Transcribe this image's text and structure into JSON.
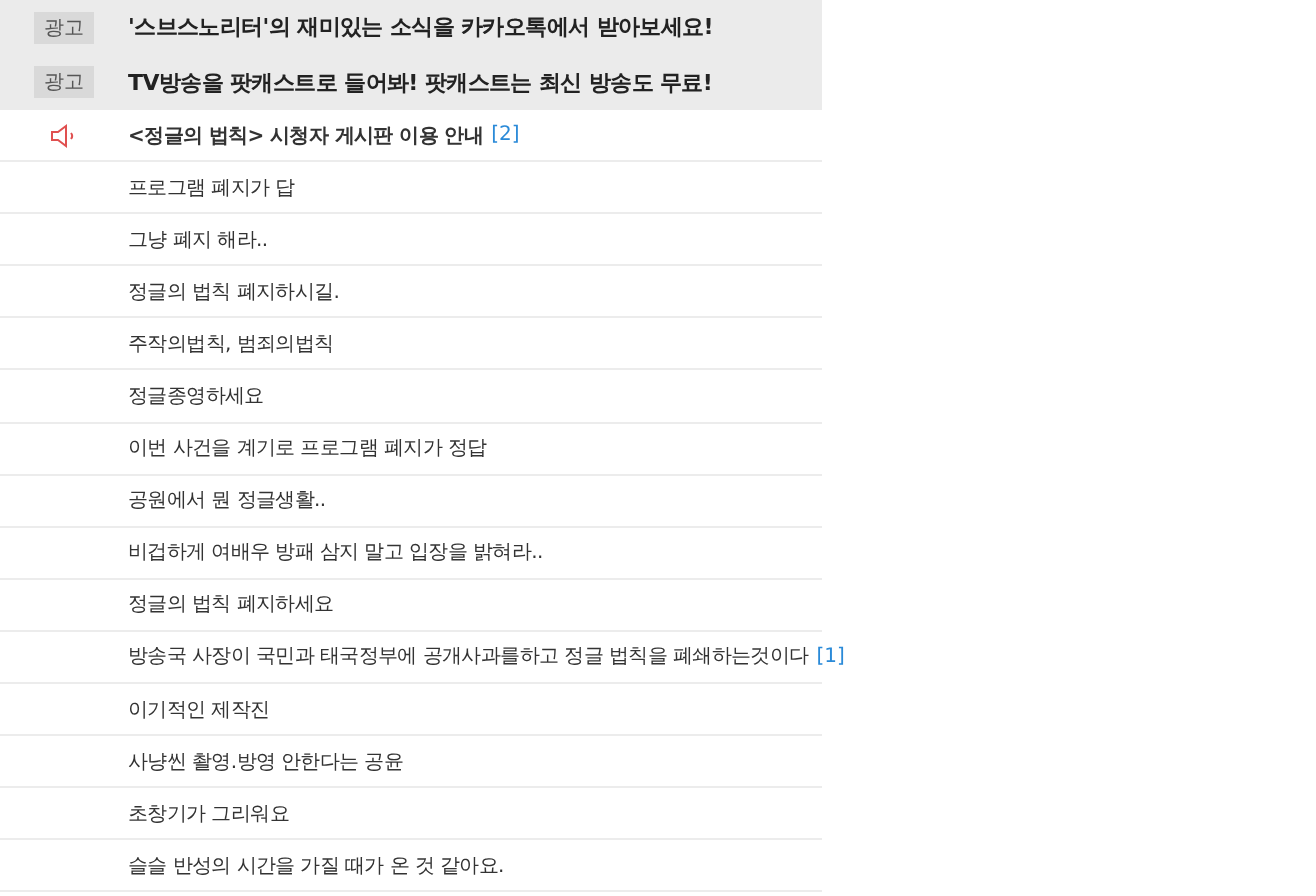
{
  "rows": [
    {
      "kind": "ad",
      "badge": "광고",
      "title": "'스브스노리터'의 재미있는 소식을 카카오톡에서 받아보세요!"
    },
    {
      "kind": "ad",
      "badge": "광고",
      "title": "TV방송을 팟캐스트로 들어봐! 팟캐스트는 최신 방송도 무료!"
    },
    {
      "kind": "notice",
      "title": "<정글의 법칙> 시청자 게시판 이용 안내",
      "comments": "[2]"
    },
    {
      "kind": "post",
      "title": "프로그램 폐지가 답"
    },
    {
      "kind": "post",
      "title": "그냥 폐지 해라.."
    },
    {
      "kind": "post",
      "title": "정글의 법칙 폐지하시길."
    },
    {
      "kind": "post",
      "title": "주작의법칙, 범죄의법칙"
    },
    {
      "kind": "post",
      "title": "정글종영하세요"
    },
    {
      "kind": "post",
      "title": "이번 사건을 계기로 프로그램 폐지가 정답"
    },
    {
      "kind": "post",
      "title": "공원에서 뭔 정글생활.."
    },
    {
      "kind": "post",
      "title": "비겁하게 여배우 방패 삼지 말고 입장을 밝혀라.."
    },
    {
      "kind": "post",
      "title": "정글의 법칙 폐지하세요"
    },
    {
      "kind": "post",
      "title": "방송국 사장이 국민과 태국정부에 공개사과를하고 정글 법칙을 폐쇄하는것이다",
      "comments": "[1]"
    },
    {
      "kind": "post",
      "title": "이기적인 제작진"
    },
    {
      "kind": "post",
      "title": "사냥씬 촬영.방영 안한다는 공윤"
    },
    {
      "kind": "post",
      "title": "초창기가 그리워요"
    },
    {
      "kind": "post",
      "title": "슬슬 반성의 시간을 가질 때가 온 것 같아요."
    }
  ]
}
